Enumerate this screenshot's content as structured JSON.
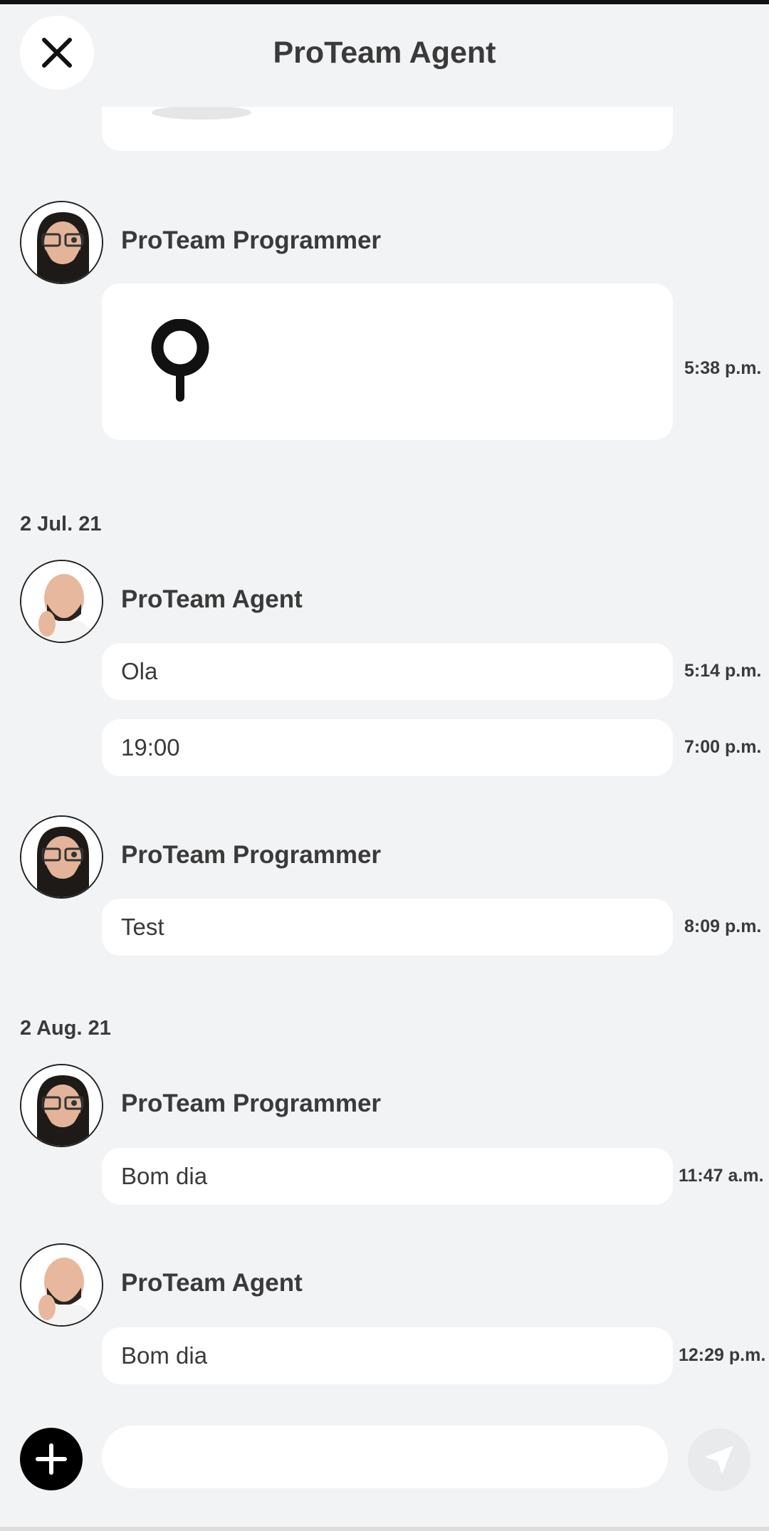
{
  "header": {
    "title": "ProTeam Agent"
  },
  "groups": [
    {
      "date": "2 Jul. 21"
    },
    {
      "date": "2 Aug. 21"
    }
  ],
  "messages": [
    {
      "sender": "ProTeam Programmer",
      "type": "location-image",
      "time": "5:38 p.m."
    },
    {
      "sender": "ProTeam Agent",
      "text": "Ola",
      "time": "5:14 p.m."
    },
    {
      "text": "19:00",
      "time": "7:00 p.m."
    },
    {
      "sender": "ProTeam Programmer",
      "text": "Test",
      "time": "8:09 p.m."
    },
    {
      "sender": "ProTeam Programmer",
      "text": "Bom dia",
      "time": "11:47 a.m."
    },
    {
      "sender": "ProTeam Agent",
      "text": "Bom dia",
      "time": "12:29 p.m."
    }
  ],
  "composer": {
    "placeholder": ""
  },
  "icons": {
    "close": "close-icon",
    "add": "plus-icon",
    "send": "send-icon",
    "pin": "location-pin-icon"
  },
  "colors": {
    "background": "#f2f3f5",
    "bubble": "#ffffff",
    "text": "#3a3a3a",
    "add_button": "#000000",
    "send_button": "#e9eaec"
  }
}
